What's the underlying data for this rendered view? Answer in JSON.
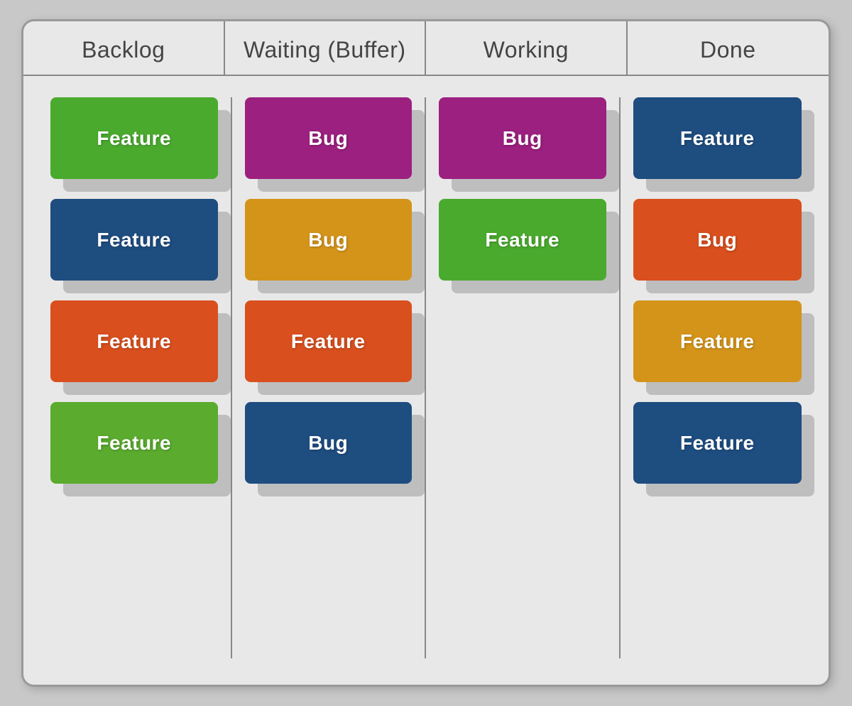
{
  "board": {
    "columns": [
      {
        "id": "backlog",
        "label": "Backlog",
        "cards": [
          {
            "label": "Feature",
            "color": "green"
          },
          {
            "label": "Feature",
            "color": "blue"
          },
          {
            "label": "Feature",
            "color": "orange"
          },
          {
            "label": "Feature",
            "color": "green2"
          }
        ]
      },
      {
        "id": "waiting",
        "label": "Waiting (Buffer)",
        "cards": [
          {
            "label": "Bug",
            "color": "purple"
          },
          {
            "label": "Bug",
            "color": "yellow"
          },
          {
            "label": "Feature",
            "color": "orange"
          },
          {
            "label": "Bug",
            "color": "blue"
          }
        ]
      },
      {
        "id": "working",
        "label": "Working",
        "cards": [
          {
            "label": "Bug",
            "color": "purple"
          },
          {
            "label": "Feature",
            "color": "green"
          }
        ]
      },
      {
        "id": "done",
        "label": "Done",
        "cards": [
          {
            "label": "Feature",
            "color": "blue"
          },
          {
            "label": "Bug",
            "color": "orange"
          },
          {
            "label": "Feature",
            "color": "yellow"
          },
          {
            "label": "Feature",
            "color": "blue"
          }
        ]
      }
    ]
  }
}
